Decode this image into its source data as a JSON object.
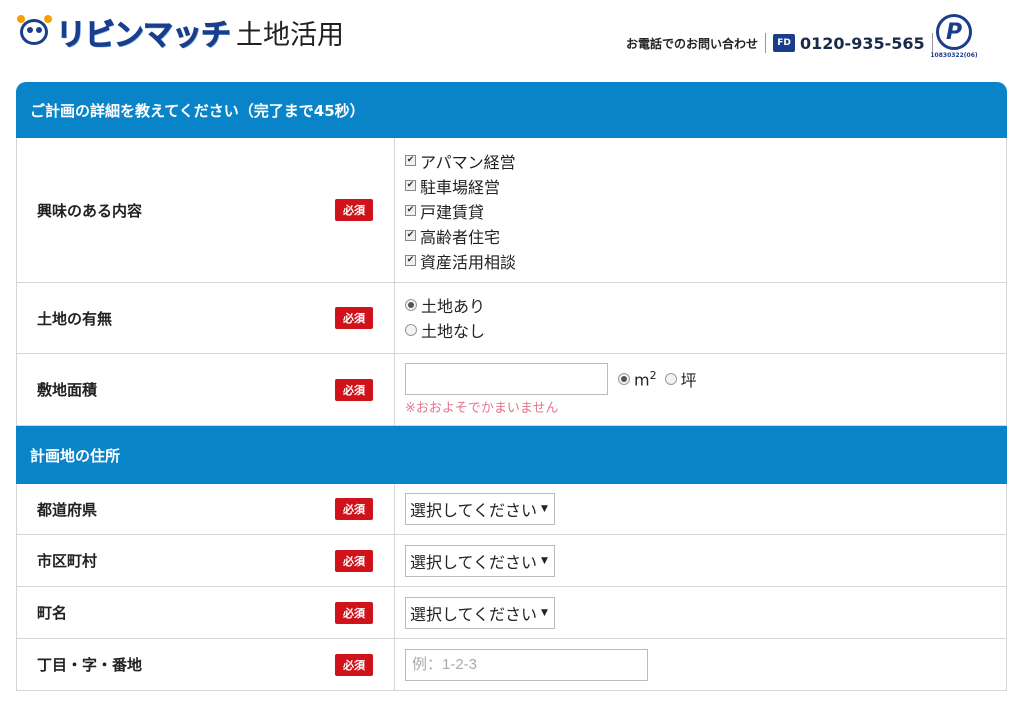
{
  "header": {
    "brand": "リビンマッチ",
    "brand_sub": "土地活用",
    "contact_label": "お電話でのお問い合わせ",
    "freedial_icon": "freedial-icon",
    "freedial_text": "FD",
    "phone": "0120-935-565",
    "privacy_mark_number": "10830322(06)",
    "privacy_mark_letter": "P"
  },
  "form": {
    "section1_title": "ご計画の詳細を教えてください（完了まで45秒）",
    "section2_title": "計画地の住所",
    "required_label": "必須",
    "interest": {
      "label": "興味のある内容",
      "options": [
        "アパマン経営",
        "駐車場経営",
        "戸建賃貸",
        "高齢者住宅",
        "資産活用相談"
      ]
    },
    "land": {
      "label": "土地の有無",
      "options": [
        "土地あり",
        "土地なし"
      ],
      "selected": "土地あり"
    },
    "area": {
      "label": "敷地面積",
      "value": "",
      "unit_m": "m",
      "unit_m_sup": "2",
      "unit_tsubo": "坪",
      "selected_unit": "m2",
      "note": "※おおよそでかまいません"
    },
    "prefecture": {
      "label": "都道府県",
      "value": "選択してください"
    },
    "city": {
      "label": "市区町村",
      "value": "選択してください"
    },
    "town": {
      "label": "町名",
      "value": "選択してください"
    },
    "block": {
      "label": "丁目・字・番地",
      "placeholder": "例：1-2-3",
      "value": ""
    }
  },
  "colors": {
    "section_bar": "#0a84c8",
    "required_badge": "#d0121b",
    "note_text": "#e8738e",
    "brand_blue": "#1a3e8c"
  }
}
